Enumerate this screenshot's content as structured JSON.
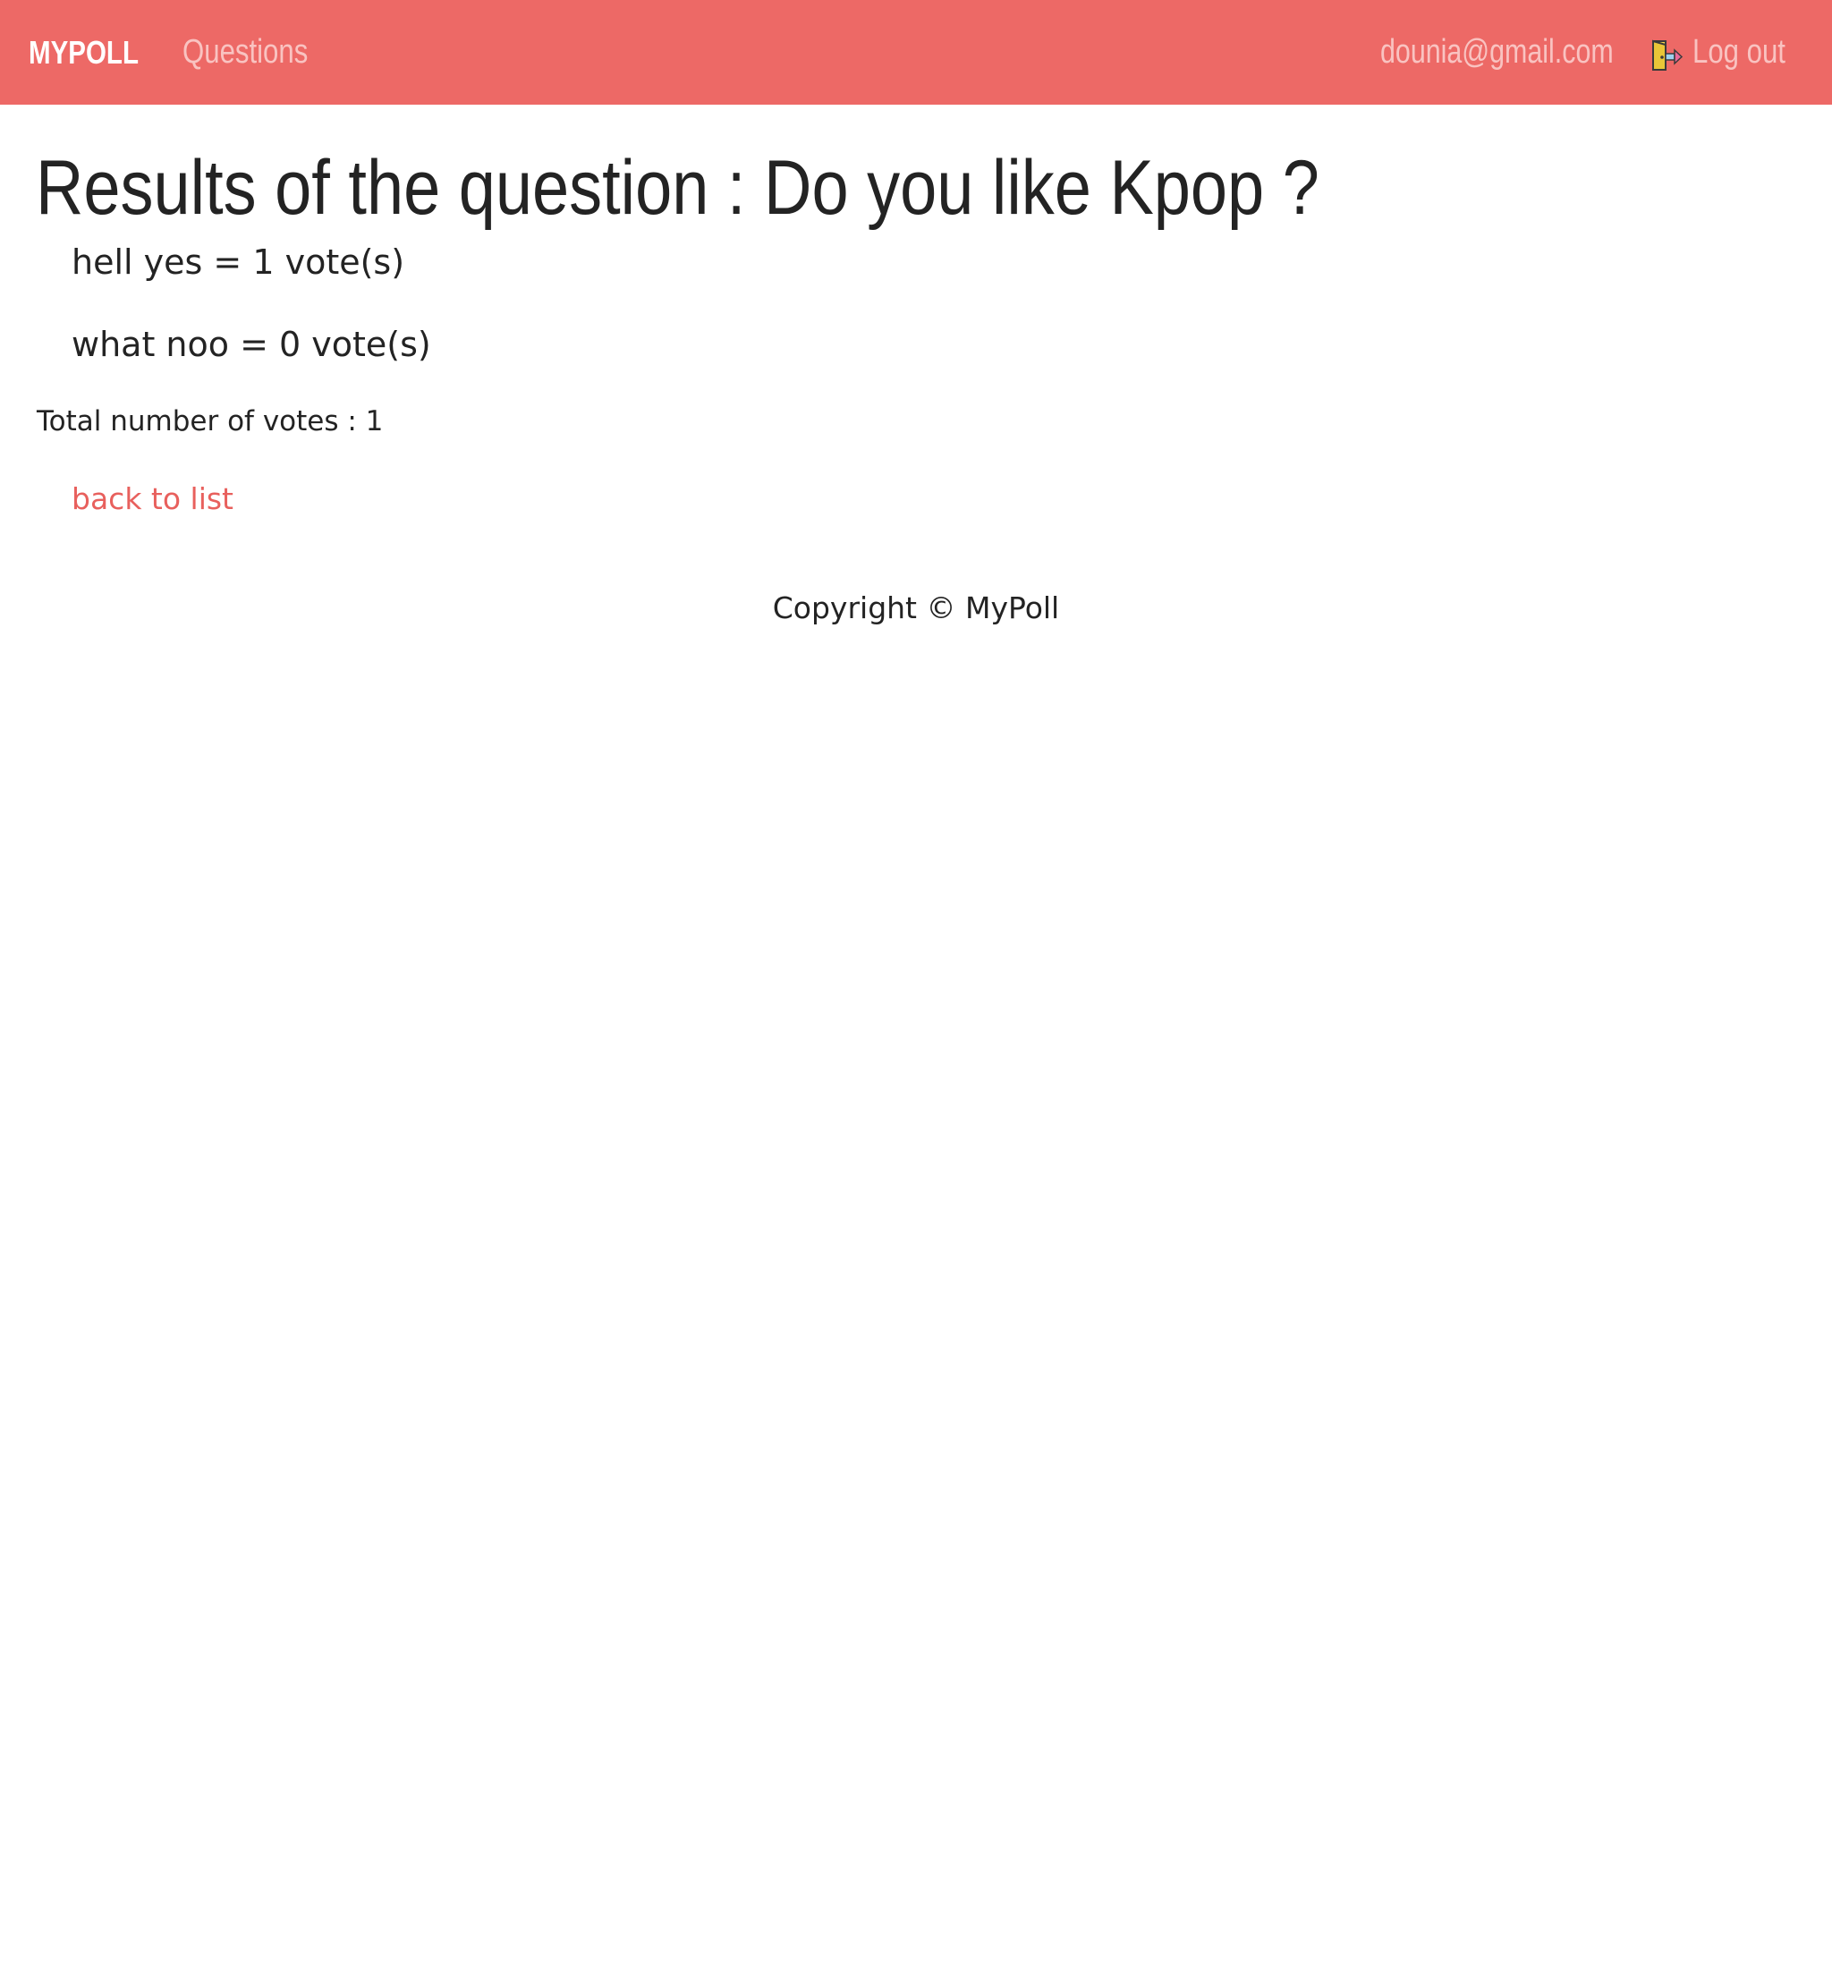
{
  "navbar": {
    "brand": "MYPOLL",
    "questions_link": "Questions",
    "user_email": "dounia@gmail.com",
    "logout_label": "Log out",
    "logout_icon": "door-exit-icon",
    "background_color": "#ed6966"
  },
  "page": {
    "title": "Results of the question : Do you like Kpop ?",
    "choices": [
      {
        "label": "hell yes = 1 vote(s)"
      },
      {
        "label": "what noo = 0 vote(s)"
      }
    ],
    "total_votes": "Total number of votes : 1",
    "back_link": "back to list",
    "link_color": "#e8605d"
  },
  "footer": {
    "copyright": "Copyright © MyPoll"
  }
}
